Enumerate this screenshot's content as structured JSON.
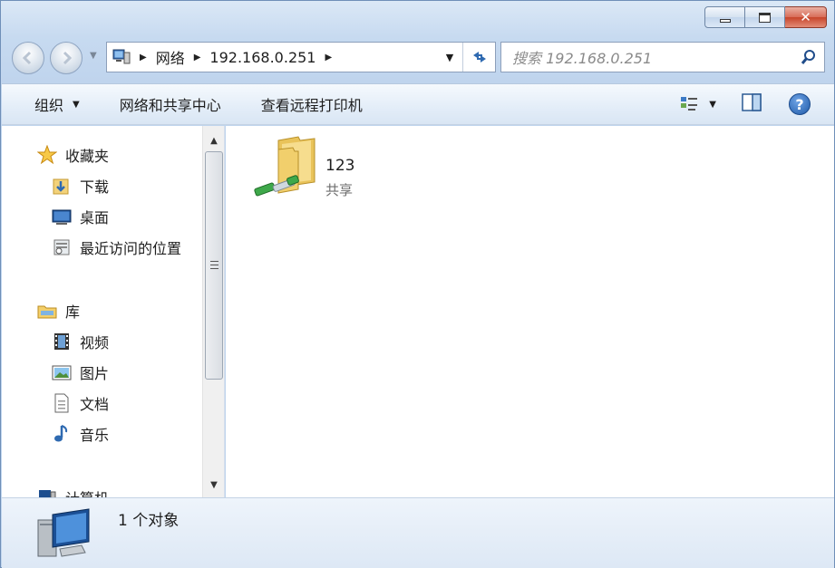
{
  "window": {
    "caption": {
      "minimize": "",
      "maximize": "",
      "close": "✕"
    }
  },
  "address": {
    "crumbs": [
      "网络",
      "192.168.0.251"
    ],
    "search_placeholder": "搜索 192.168.0.251"
  },
  "toolbar": {
    "organize": "组织",
    "network_center": "网络和共享中心",
    "view_printers": "查看远程打印机"
  },
  "navpane": {
    "favorites": "收藏夹",
    "downloads": "下载",
    "desktop": "桌面",
    "recent": "最近访问的位置",
    "libraries": "库",
    "videos": "视频",
    "pictures": "图片",
    "documents": "文档",
    "music": "音乐",
    "computer": "计算机"
  },
  "content": {
    "items": [
      {
        "name": "123",
        "type": "共享"
      }
    ]
  },
  "details": {
    "count_text": "1 个对象"
  },
  "icons": {
    "nav_back": "back-arrow-icon",
    "nav_forward": "forward-arrow-icon",
    "refresh": "refresh-icon",
    "search": "search-icon",
    "help": "help-icon"
  }
}
